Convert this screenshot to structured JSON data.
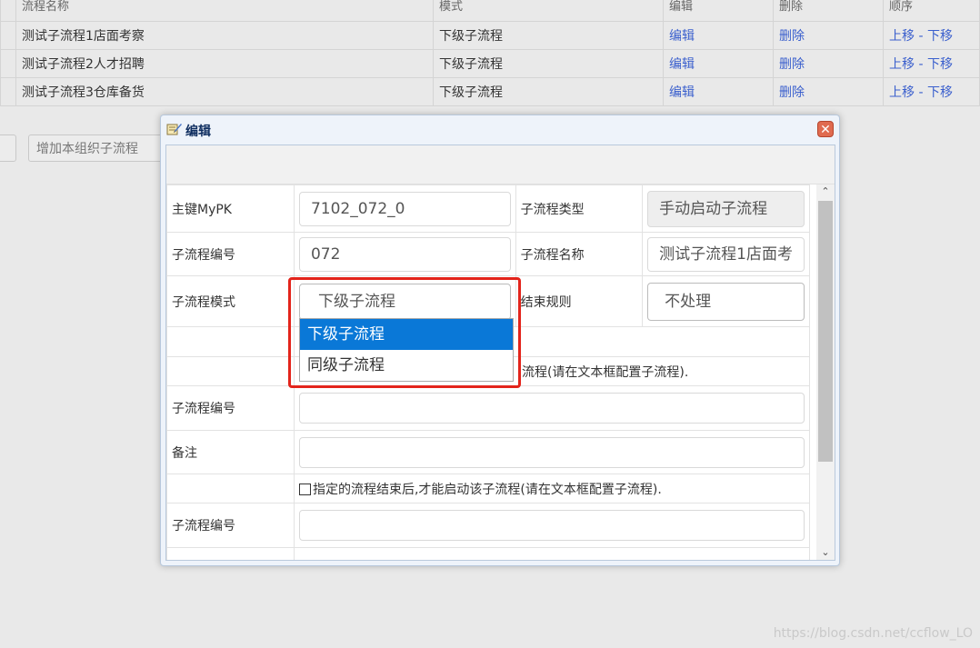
{
  "background_table": {
    "headers": [
      "流程名称",
      "模式",
      "编辑",
      "删除",
      "顺序"
    ],
    "rows": [
      {
        "name": "测试子流程1店面考察",
        "mode": "下级子流程",
        "edit": "编辑",
        "delete": "删除",
        "up": "上移",
        "sep": " - ",
        "down": "下移"
      },
      {
        "name": "测试子流程2人才招聘",
        "mode": "下级子流程",
        "edit": "编辑",
        "delete": "删除",
        "up": "上移",
        "sep": " - ",
        "down": "下移"
      },
      {
        "name": "测试子流程3仓库备货",
        "mode": "下级子流程",
        "edit": "编辑",
        "delete": "删除",
        "up": "上移",
        "sep": " - ",
        "down": "下移"
      }
    ],
    "add_button": "增加本组织子流程"
  },
  "dialog": {
    "title": "编辑",
    "close_symbol": "✕",
    "fields": {
      "mypk_label": "主键MyPK",
      "mypk_value": "7102_072_0",
      "subflow_type_label": "子流程类型",
      "subflow_type_value": "手动启动子流程",
      "subflow_no_label": "子流程编号",
      "subflow_no_value": "072",
      "subflow_name_label": "子流程名称",
      "subflow_name_value": "测试子流程1店面考",
      "subflow_mode_label": "子流程模式",
      "subflow_mode_value": "下级子流程",
      "end_rule_label": "结束规则",
      "end_rule_value": "不处理",
      "partial_text": "流程(请在文本框配置子流程).",
      "subflow_no_label_2": "子流程编号",
      "remark_label": "备注",
      "checkbox_text": "指定的流程结束后,才能启动该子流程(请在文本框配置子流程).",
      "subflow_no_label_3": "子流程编号"
    },
    "dropdown_options": [
      {
        "label": "下级子流程",
        "selected": true
      },
      {
        "label": "同级子流程",
        "selected": false
      }
    ],
    "scroll_up": "⌃",
    "scroll_down": "⌄"
  },
  "watermark": "https://blog.csdn.net/ccflow_LO",
  "colors": {
    "highlight": "#e3241b",
    "selected_option": "#0a78d7",
    "link": "#3a5fcd",
    "label_blue": "#2f6fb0"
  }
}
